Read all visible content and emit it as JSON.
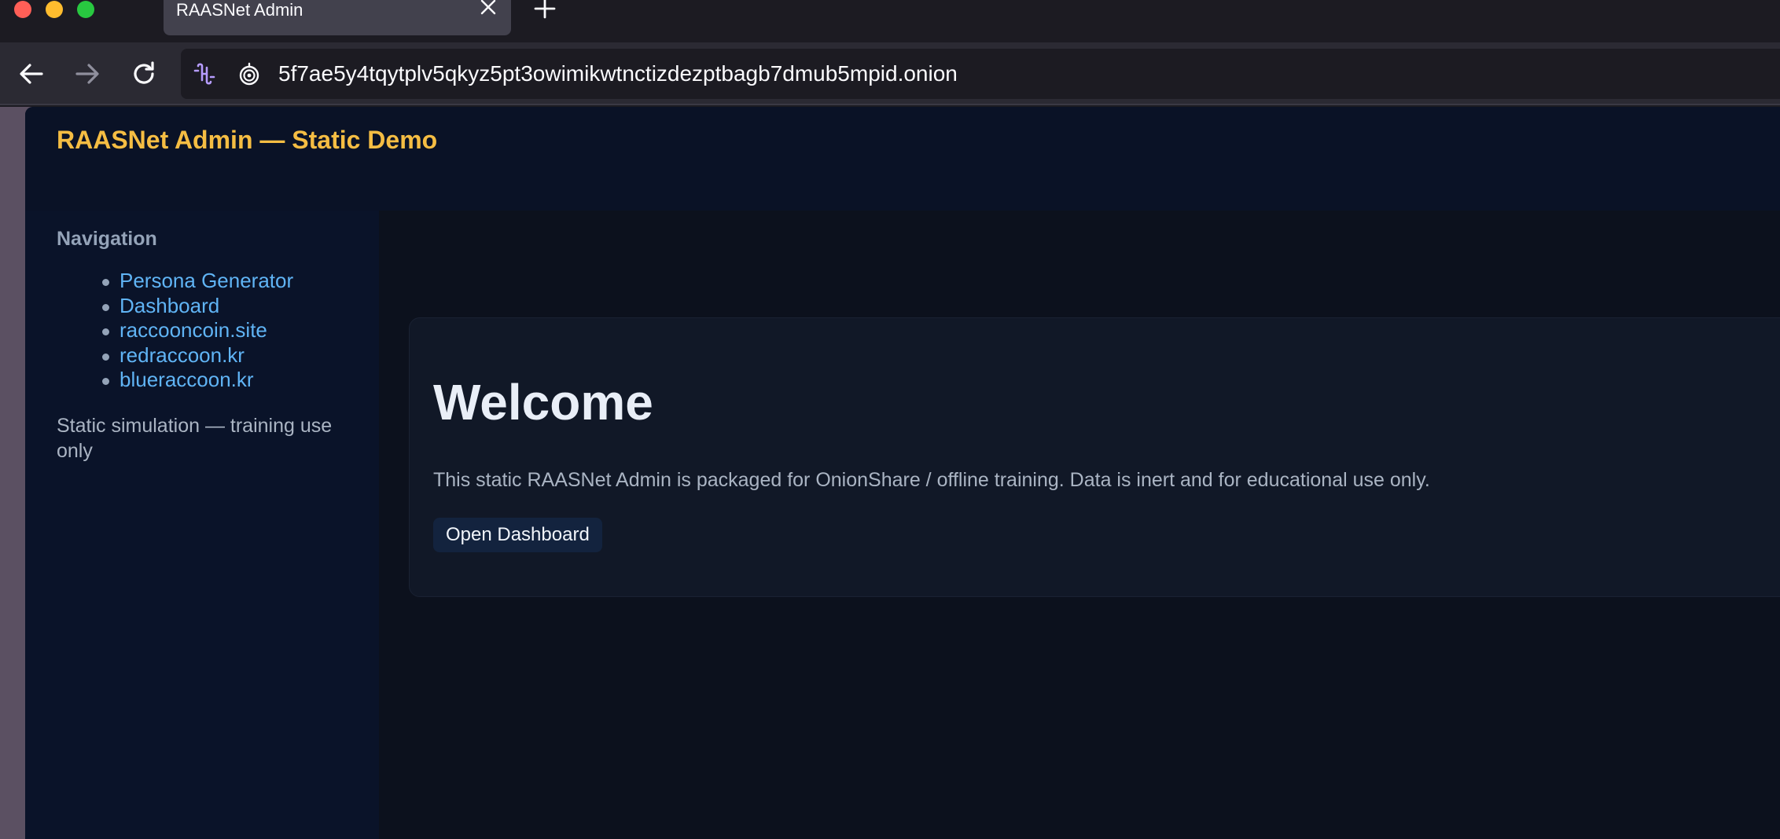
{
  "browser": {
    "tab_title": "RAASNet Admin",
    "url": "5f7ae5y4tqytplv5qkyz5pt3owimikwtnctizdezptbagb7dmub5mpid.onion",
    "icons": {
      "close": "close-icon",
      "new_tab": "plus-icon",
      "back": "arrow-left-icon",
      "forward": "arrow-right-icon",
      "reload": "reload-icon",
      "extension": "extension-icon",
      "onion": "onion-icon"
    }
  },
  "header": {
    "brand": "RAASNet Admin — Static Demo"
  },
  "sidebar": {
    "heading": "Navigation",
    "items": [
      {
        "label": "Persona Generator"
      },
      {
        "label": "Dashboard"
      },
      {
        "label": "raccooncoin.site"
      },
      {
        "label": "redraccoon.kr"
      },
      {
        "label": "blueraccoon.kr"
      }
    ],
    "note": "Static simulation — training use only"
  },
  "main": {
    "title": "Welcome",
    "description": "This static RAASNet Admin is packaged for OnionShare / offline training. Data is inert and for educational use only.",
    "button_label": "Open Dashboard"
  },
  "colors": {
    "brand": "#f5bd43",
    "link": "#60b4f5",
    "background": "#0b1222",
    "card": "#111827"
  }
}
